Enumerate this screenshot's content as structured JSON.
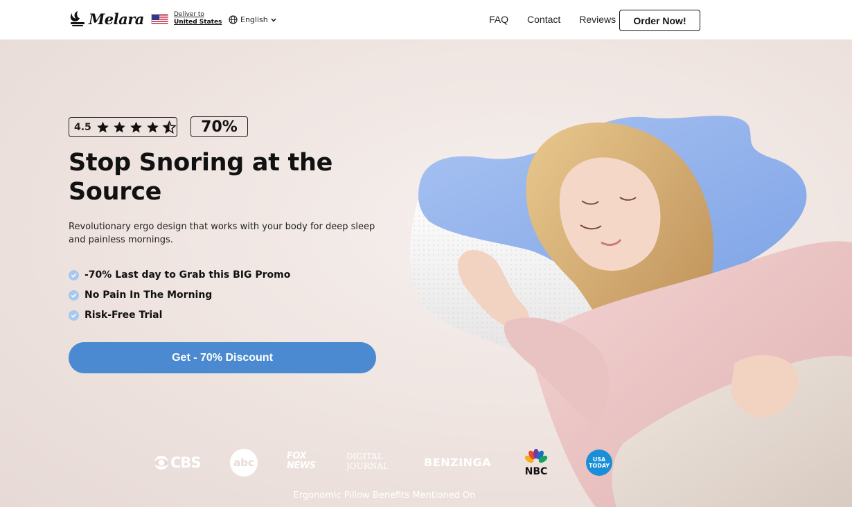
{
  "header": {
    "logo": "Melara",
    "deliver_to_label": "Deliver to",
    "deliver_country": "United States",
    "language": "English",
    "nav": [
      "FAQ",
      "Contact",
      "Reviews"
    ],
    "order_button": "Order Now!"
  },
  "hero": {
    "rating_value": "4.5",
    "rating_stars": 4.5,
    "discount_badge": "70%",
    "headline": "Stop Snoring at the Source",
    "subheadline": "Revolutionary ergo design that works with your body for deep sleep and painless mornings.",
    "features": [
      "-70% Last day to Grab this BIG Promo",
      "No Pain In The Morning",
      "Risk-Free Trial"
    ],
    "cta": "Get - 70% Discount"
  },
  "press": {
    "logos": [
      "CBS",
      "abc",
      "FOX NEWS",
      "DIGITAL JOURNAL",
      "BENZINGA",
      "NBC",
      "USA TODAY"
    ],
    "caption": "Ergonomic Pillow Benefits Mentioned On"
  },
  "colors": {
    "accent": "#4b8ad1",
    "check": "#a9c8ef",
    "background": "#f1e9e6"
  }
}
